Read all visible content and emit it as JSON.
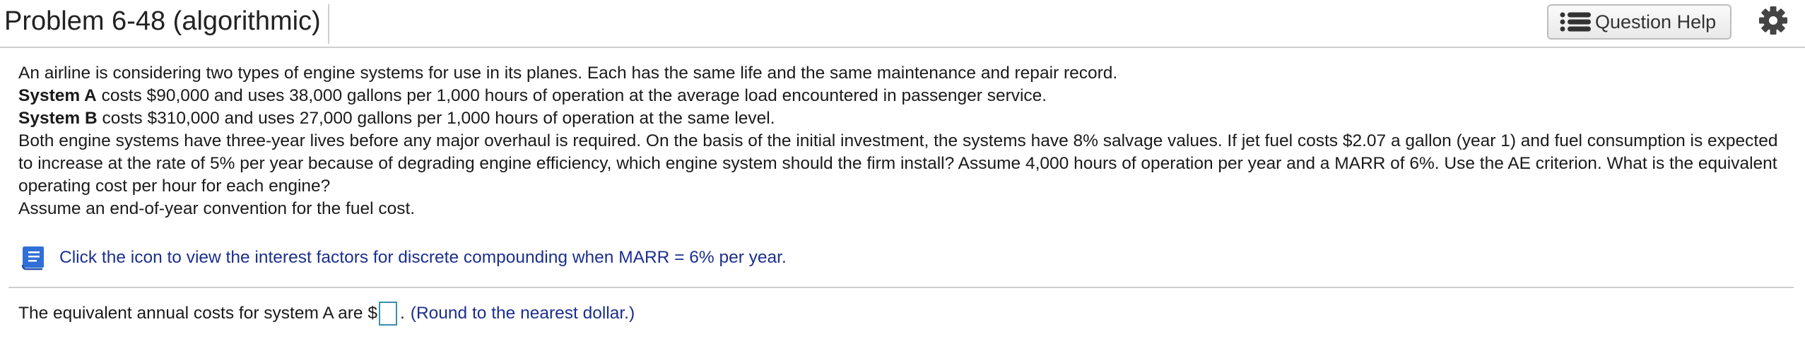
{
  "header": {
    "title": "Problem 6-48 (algorithmic)",
    "question_help_label": "Question Help"
  },
  "problem": {
    "intro": "An airline is considering two types of engine systems for use in its planes. Each has the same life and the same maintenance and repair record.",
    "system_a_label": "System A",
    "system_a_text": " costs $90,000 and uses 38,000 gallons per 1,000 hours of operation at the average load encountered in passenger service.",
    "system_b_label": "System B",
    "system_b_text": " costs $310,000 and uses 27,000 gallons per 1,000 hours of operation at the same level.",
    "body": "Both engine systems have three-year lives before any major overhaul is required. On the basis of the initial investment, the systems have 8% salvage values. If jet fuel costs $2.07 a gallon (year 1) and fuel consumption is expected to increase at the rate of 5% per year because of degrading engine efficiency, which engine system should the firm install? Assume 4,000 hours of operation per year and a MARR of 6%. Use the AE criterion. What is the equivalent operating cost per hour for each engine?",
    "assumption": "Assume an end-of-year convention for the fuel cost."
  },
  "help_link": {
    "text": "Click the icon to view the interest factors for discrete compounding when MARR = 6% per year."
  },
  "answer": {
    "prefix": "The equivalent annual costs for system A are $",
    "input_value": "",
    "suffix": ".",
    "hint": "(Round to the nearest dollar.)"
  },
  "colors": {
    "link_blue": "#1c2f8f",
    "book_blue": "#2f6fd6",
    "input_border": "#3a8fb0"
  }
}
